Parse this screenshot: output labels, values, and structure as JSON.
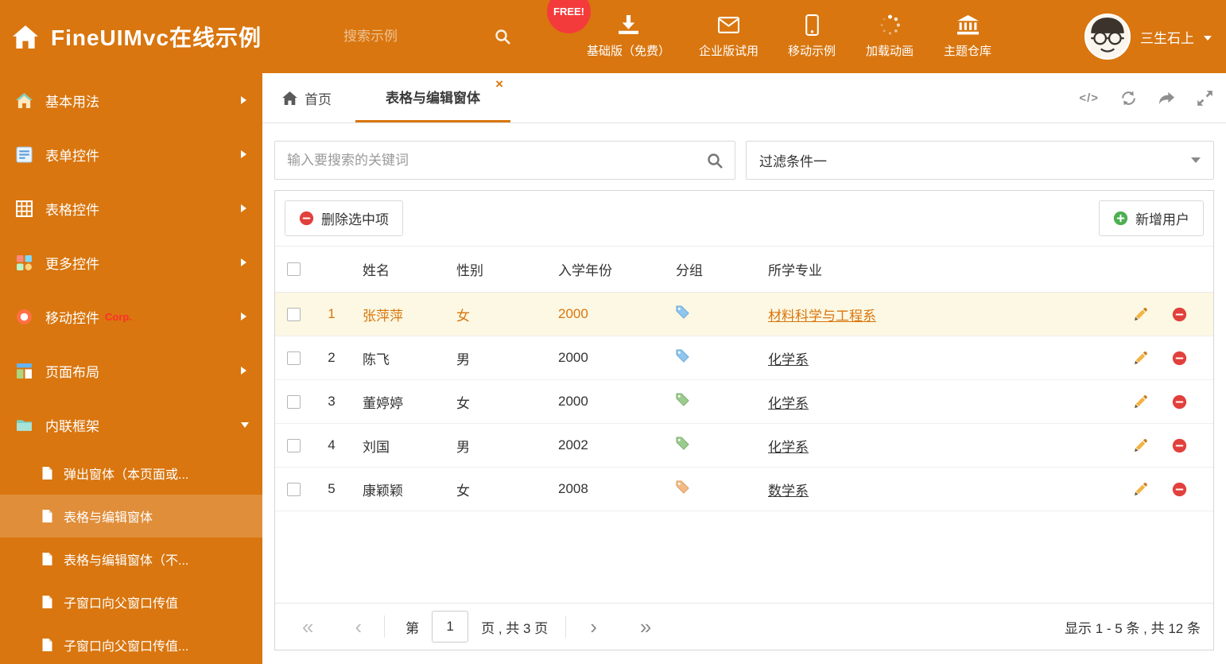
{
  "colors": {
    "primary": "#d9760f",
    "badge_red": "#f43b3b",
    "selected_row_bg": "#fcf8e3",
    "tag_blue": "#8ec6ee",
    "tag_green": "#9ccb8f",
    "tag_orange": "#f2bb85"
  },
  "icons": {
    "close": "×",
    "first": "«",
    "prev": "‹",
    "next": "›",
    "last": "»",
    "code": "</>"
  },
  "header": {
    "title": "FineUIMvc在线示例",
    "search_placeholder": "搜索示例",
    "free_badge": "FREE!",
    "nav": [
      {
        "label": "基础版（免费）",
        "icon": "download-icon"
      },
      {
        "label": "企业版试用",
        "icon": "mail-icon"
      },
      {
        "label": "移动示例",
        "icon": "mobile-icon"
      },
      {
        "label": "加载动画",
        "icon": "spinner-icon"
      },
      {
        "label": "主题仓库",
        "icon": "bank-icon"
      }
    ],
    "user_name": "三生石上"
  },
  "sidebar": {
    "items": [
      {
        "label": "基本用法"
      },
      {
        "label": "表单控件"
      },
      {
        "label": "表格控件"
      },
      {
        "label": "更多控件"
      },
      {
        "label": "移动控件",
        "badge": "Corp."
      },
      {
        "label": "页面布局"
      },
      {
        "label": "内联框架",
        "expanded": true
      }
    ],
    "subitems": [
      {
        "label": "弹出窗体（本页面或..."
      },
      {
        "label": "表格与编辑窗体",
        "active": true
      },
      {
        "label": "表格与编辑窗体（不..."
      },
      {
        "label": "子窗口向父窗口传值"
      },
      {
        "label": "子窗口向父窗口传值..."
      }
    ]
  },
  "tabs": {
    "home": "首页",
    "active": "表格与编辑窗体"
  },
  "filters": {
    "search_placeholder": "输入要搜索的关键词",
    "selected_filter": "过滤条件一"
  },
  "toolbar": {
    "delete_label": "删除选中项",
    "add_label": "新增用户"
  },
  "table": {
    "columns": {
      "name": "姓名",
      "gender": "性别",
      "year": "入学年份",
      "group": "分组",
      "major": "所学专业"
    },
    "rows": [
      {
        "num": "1",
        "name": "张萍萍",
        "gender": "女",
        "year": "2000",
        "tag": "blue",
        "major": "材料科学与工程系",
        "selected": true
      },
      {
        "num": "2",
        "name": "陈飞",
        "gender": "男",
        "year": "2000",
        "tag": "blue",
        "major": "化学系",
        "selected": false
      },
      {
        "num": "3",
        "name": "董婷婷",
        "gender": "女",
        "year": "2000",
        "tag": "green",
        "major": "化学系",
        "selected": false
      },
      {
        "num": "4",
        "name": "刘国",
        "gender": "男",
        "year": "2002",
        "tag": "green",
        "major": "化学系",
        "selected": false
      },
      {
        "num": "5",
        "name": "康颖颖",
        "gender": "女",
        "year": "2008",
        "tag": "orange",
        "major": "数学系",
        "selected": false
      }
    ]
  },
  "pagination": {
    "prefix": "第",
    "page_value": "1",
    "suffix": "页 , 共 3 页",
    "summary": "显示 1 - 5 条 , 共 12 条"
  }
}
